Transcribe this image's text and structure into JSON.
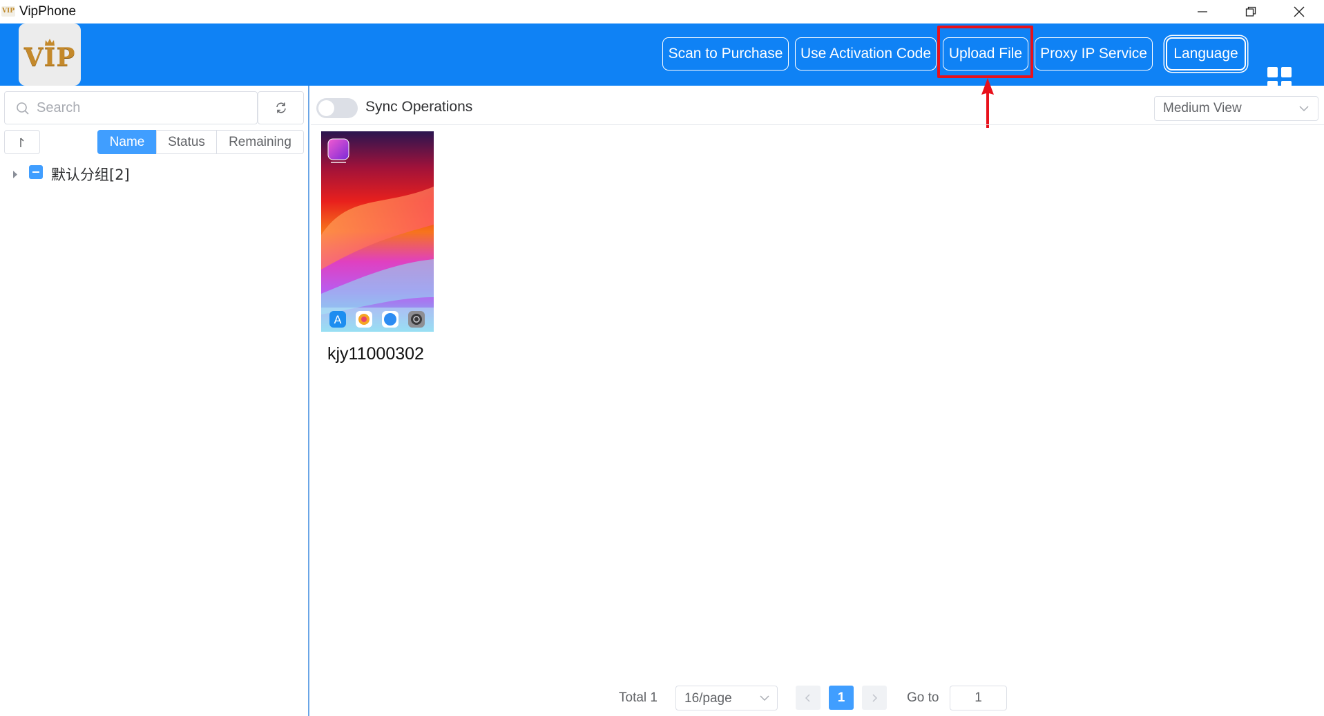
{
  "window": {
    "title": "VipPhone",
    "app_icon_text": "VIP",
    "controls": [
      "minimize-icon",
      "restore-icon",
      "close-icon"
    ]
  },
  "header": {
    "logo_text": "VIP",
    "buttons": {
      "scan": "Scan to Purchase",
      "activation": "Use Activation Code",
      "upload": "Upload File",
      "proxy": "Proxy IP Service",
      "language": "Language"
    },
    "grid_icon": "grid-icon",
    "colors": {
      "background": "#0f82f5",
      "highlight": "#e8111b"
    }
  },
  "sidebar": {
    "search_placeholder": "Search",
    "sort_tabs": {
      "name": "Name",
      "status": "Status",
      "remaining": "Remaining"
    },
    "active_sort": "Name",
    "group_label": "默认分组[2]"
  },
  "main": {
    "sync_label": "Sync Operations",
    "sync_enabled": false,
    "view_mode": "Medium View",
    "devices": [
      {
        "label": "kjy11000302"
      }
    ]
  },
  "pagination": {
    "total": "Total 1",
    "page_size": "16/page",
    "current_page": "1",
    "goto_label": "Go to",
    "goto_value": "1"
  }
}
